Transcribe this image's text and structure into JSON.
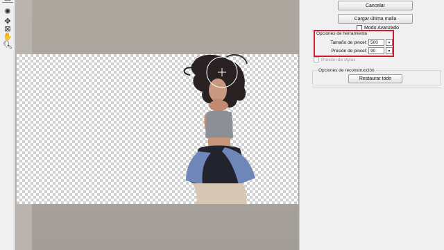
{
  "toolbar": {
    "tools": [
      {
        "icon": "reconstruct-icon"
      },
      {
        "icon": "pucker-icon"
      },
      {
        "icon": "bloat-icon"
      },
      {
        "icon": "freeze-mask-icon"
      },
      {
        "icon": "hand-icon"
      },
      {
        "icon": "zoom-icon"
      }
    ]
  },
  "panel": {
    "cancel_label": "Cancelar",
    "load_mesh_label": "Cargar última malla",
    "advanced_mode_label": "Modo Avanzado",
    "tool_options": {
      "title": "Opciones de herramienta",
      "brush_size_label": "Tamaño de pincel:",
      "brush_size_value": "500",
      "brush_pressure_label": "Presión de pincel:",
      "brush_pressure_value": "90",
      "highlight_color": "#d11a2a"
    },
    "stylus_pressure_label": "Presión de stylus",
    "reconstruction": {
      "title": "Opciones de reconstrucción",
      "restore_all_label": "Restaurar todo"
    }
  }
}
